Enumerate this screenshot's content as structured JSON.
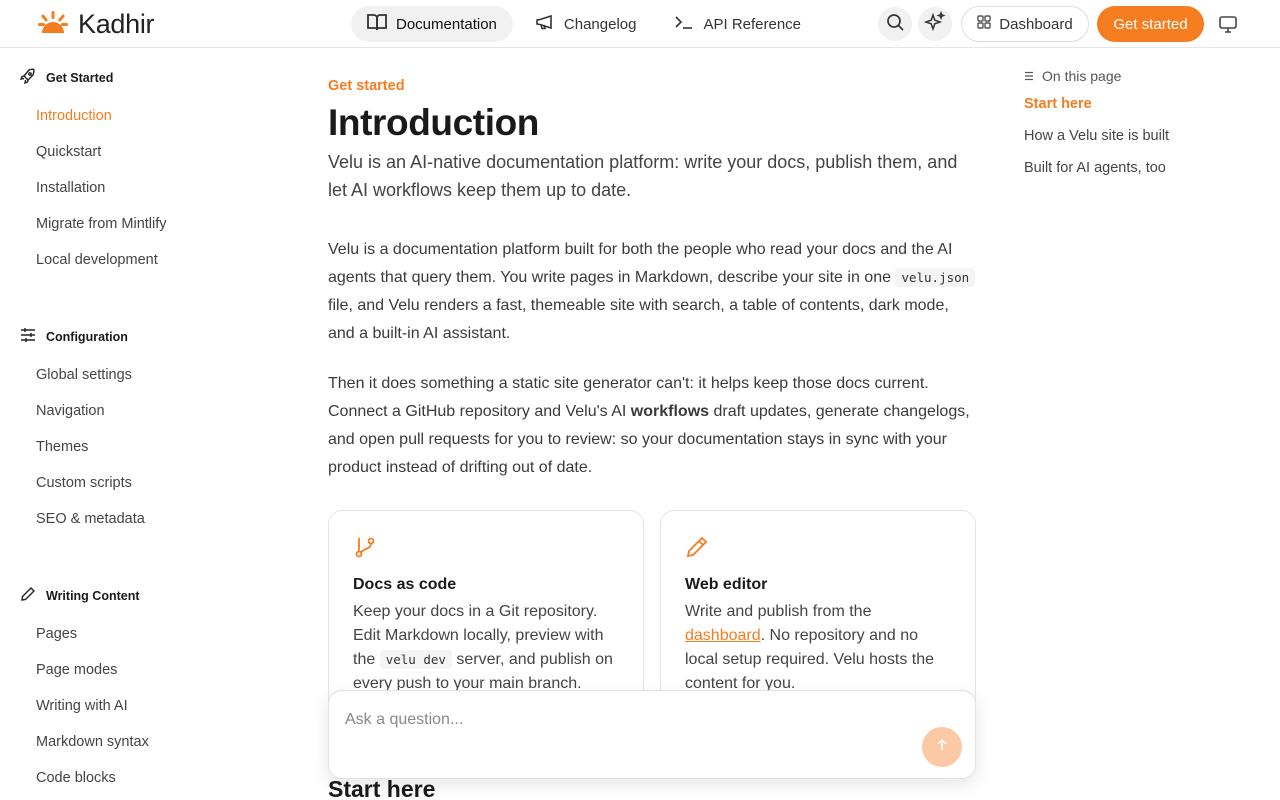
{
  "brand": {
    "name": "Kadhir",
    "color": "#f57c1f"
  },
  "header": {
    "tabs": [
      {
        "label": "Documentation",
        "icon": "book-icon",
        "active": true
      },
      {
        "label": "Changelog",
        "icon": "megaphone-icon",
        "active": false
      },
      {
        "label": "API Reference",
        "icon": "terminal-icon",
        "active": false
      }
    ],
    "dashboard_label": "Dashboard",
    "get_started_label": "Get started"
  },
  "sidebar": {
    "sections": [
      {
        "title": "Get Started",
        "icon": "rocket-icon",
        "items": [
          "Introduction",
          "Quickstart",
          "Installation",
          "Migrate from Mintlify",
          "Local development"
        ]
      },
      {
        "title": "Configuration",
        "icon": "sliders-icon",
        "items": [
          "Global settings",
          "Navigation",
          "Themes",
          "Custom scripts",
          "SEO & metadata"
        ]
      },
      {
        "title": "Writing Content",
        "icon": "pencil-icon",
        "items": [
          "Pages",
          "Page modes",
          "Writing with AI",
          "Markdown syntax",
          "Code blocks"
        ]
      }
    ],
    "active_item": "Introduction"
  },
  "main": {
    "eyebrow": "Get started",
    "title": "Introduction",
    "lead": "Velu is an AI-native documentation platform: write your docs, publish them, and let AI workflows keep them up to date.",
    "p1_a": "Velu is a documentation platform built for both the people who read your docs and the AI agents that query them. You write pages in Markdown, describe your site in one",
    "p1_code": "velu.json",
    "p1_b": "file, and Velu renders a fast, themeable site with search, a table of contents, dark mode, and a built-in AI assistant.",
    "p2_a": "Then it does something a static site generator can't: it helps keep those docs current. Connect a GitHub repository and Velu's AI",
    "p2_bold": "workflows",
    "p2_b": "draft updates, generate changelogs, and open pull requests for you to review: so your documentation stays in sync with your product instead of drifting out of date.",
    "cards": [
      {
        "title": "Docs as code",
        "icon": "git-branch-icon",
        "body_a": "Keep your docs in a Git repository. Edit Markdown locally, preview with the",
        "body_code": "velu dev",
        "body_b": "server, and publish on every push to your main branch."
      },
      {
        "title": "Web editor",
        "icon": "pencil-icon",
        "body_a": "Write and publish from the",
        "body_link": "dashboard",
        "body_b": ". No repository and no local setup required. Velu hosts the content for you."
      }
    ],
    "h2": "Start here"
  },
  "ask": {
    "placeholder": "Ask a question..."
  },
  "toc": {
    "heading": "On this page",
    "items": [
      "Start here",
      "How a Velu site is built",
      "Built for AI agents, too"
    ],
    "active_item": "Start here"
  }
}
